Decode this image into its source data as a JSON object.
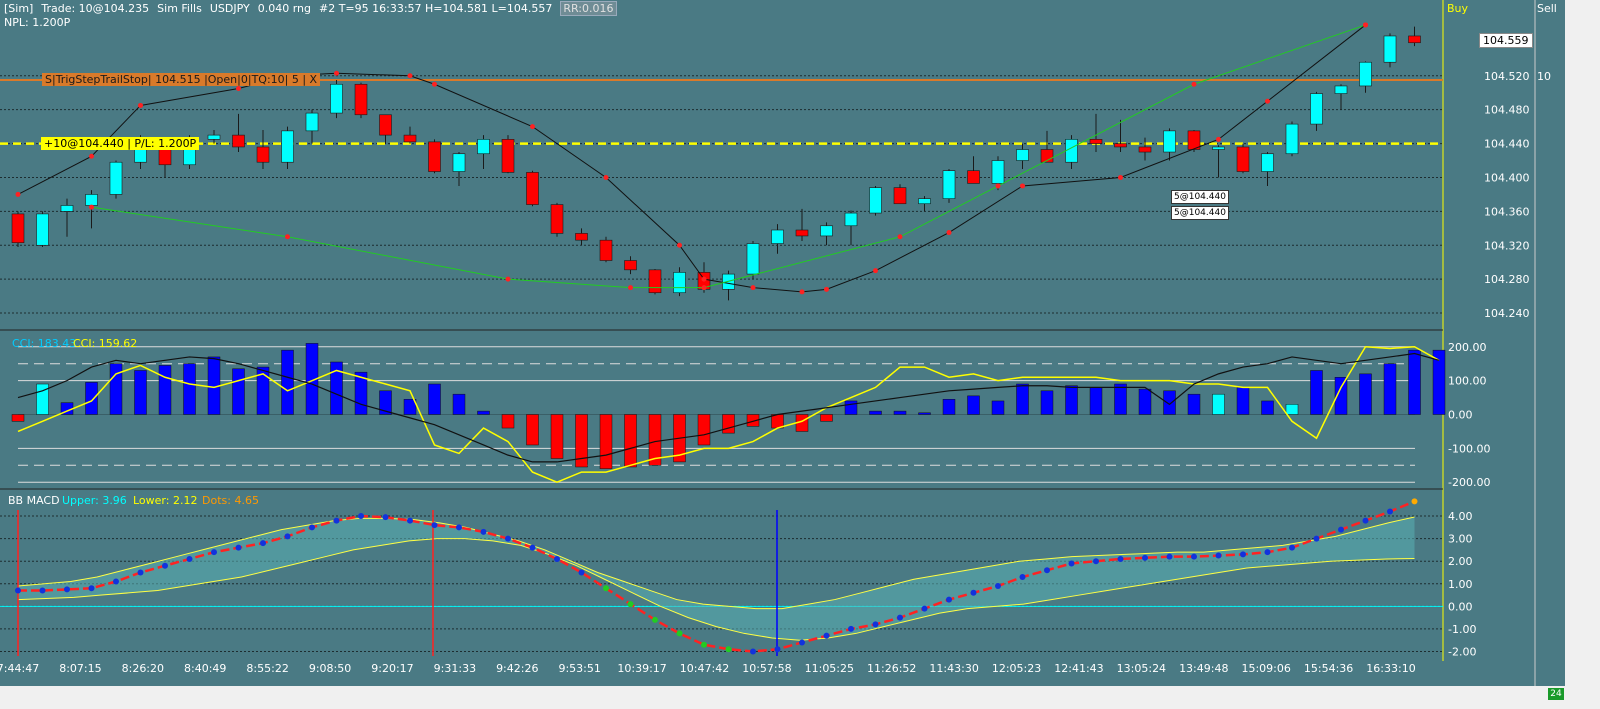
{
  "toolbar": {
    "account": "[Sim]",
    "trade": "Trade: 10@104.235",
    "fills": "Sim Fills",
    "instrument": "USDJPY",
    "range": "0.040 rng",
    "info": "#2 T=95 16:33:57 H=104.581 L=104.557",
    "rr": "RR:0.016"
  },
  "npl": "NPL: 1.200P",
  "order_label": "S|TrigStepTrailStop| 104.515 |Open|0|TQ:10| 5 | X",
  "position_label": "+10@104.440 | P/L: 1.200P",
  "fill_labels": [
    "5@104.440",
    "5@104.440"
  ],
  "buy_label": "Buy",
  "sell_label": "Sell",
  "current_price": "104.559",
  "quantity": "10",
  "corner_badge": "24",
  "colors": {
    "background": "#4a7a84",
    "bull": "#00ffff",
    "bear": "#ff0000",
    "order_line": "#d97a2a",
    "position_line": "#ffff00",
    "macd_band": "#5ab0b4"
  },
  "chart_data": [
    {
      "type": "candlestick",
      "instrument": "USDJPY",
      "ylim": [
        104.22,
        104.6
      ],
      "y_ticks": [
        "104.520",
        "104.480",
        "104.440",
        "104.400",
        "104.360",
        "104.320",
        "104.280",
        "104.240"
      ],
      "candles": [
        [
          104.357,
          104.36,
          104.318,
          104.323
        ],
        [
          104.32,
          104.36,
          104.318,
          104.357
        ],
        [
          104.36,
          104.375,
          104.33,
          104.367
        ],
        [
          104.367,
          104.385,
          104.34,
          104.38
        ],
        [
          104.38,
          104.42,
          104.375,
          104.418
        ],
        [
          104.418,
          104.45,
          104.41,
          104.44
        ],
        [
          104.44,
          104.44,
          104.4,
          104.415
        ],
        [
          104.415,
          104.45,
          104.41,
          104.445
        ],
        [
          104.445,
          104.456,
          104.44,
          104.45
        ],
        [
          104.45,
          104.475,
          104.43,
          104.436
        ],
        [
          104.436,
          104.456,
          104.41,
          104.418
        ],
        [
          104.418,
          104.46,
          104.41,
          104.455
        ],
        [
          104.455,
          104.48,
          104.44,
          104.476
        ],
        [
          104.476,
          104.515,
          104.47,
          104.51
        ],
        [
          104.51,
          104.512,
          104.47,
          104.474
        ],
        [
          104.474,
          104.474,
          104.44,
          104.45
        ],
        [
          104.45,
          104.46,
          104.44,
          104.442
        ],
        [
          104.442,
          104.445,
          104.405,
          104.407
        ],
        [
          104.407,
          104.43,
          104.39,
          104.428
        ],
        [
          104.428,
          104.45,
          104.41,
          104.445
        ],
        [
          104.445,
          104.45,
          104.405,
          104.406
        ],
        [
          104.406,
          104.408,
          104.366,
          104.368
        ],
        [
          104.368,
          104.37,
          104.33,
          104.334
        ],
        [
          104.334,
          104.34,
          104.32,
          104.326
        ],
        [
          104.326,
          104.33,
          104.3,
          104.302
        ],
        [
          104.302,
          104.307,
          104.286,
          104.291
        ],
        [
          104.291,
          104.292,
          104.262,
          104.264
        ],
        [
          104.264,
          104.294,
          104.26,
          104.288
        ],
        [
          104.288,
          104.3,
          104.264,
          104.268
        ],
        [
          104.268,
          104.29,
          104.255,
          104.286
        ],
        [
          104.286,
          104.325,
          104.28,
          104.322
        ],
        [
          104.322,
          104.345,
          104.31,
          104.338
        ],
        [
          104.338,
          104.363,
          104.325,
          104.331
        ],
        [
          104.331,
          104.347,
          104.32,
          104.343
        ],
        [
          104.343,
          104.361,
          104.32,
          104.358
        ],
        [
          104.358,
          104.39,
          104.355,
          104.388
        ],
        [
          104.388,
          104.392,
          104.37,
          104.369
        ],
        [
          104.369,
          104.378,
          104.36,
          104.375
        ],
        [
          104.375,
          104.41,
          104.37,
          104.408
        ],
        [
          104.408,
          104.425,
          104.4,
          104.393
        ],
        [
          104.393,
          104.425,
          104.385,
          104.42
        ],
        [
          104.42,
          104.44,
          104.41,
          104.433
        ],
        [
          104.433,
          104.455,
          104.42,
          104.418
        ],
        [
          104.418,
          104.45,
          104.41,
          104.445
        ],
        [
          104.445,
          104.475,
          104.43,
          104.44
        ],
        [
          104.44,
          104.468,
          104.43,
          104.436
        ],
        [
          104.436,
          104.447,
          104.42,
          104.43
        ],
        [
          104.43,
          104.458,
          104.42,
          104.455
        ],
        [
          104.455,
          104.456,
          104.43,
          104.433
        ],
        [
          104.433,
          104.438,
          104.4,
          104.436
        ],
        [
          104.436,
          104.44,
          104.405,
          104.407
        ],
        [
          104.407,
          104.43,
          104.39,
          104.428
        ],
        [
          104.428,
          104.466,
          104.425,
          104.463
        ],
        [
          104.463,
          104.501,
          104.455,
          104.499
        ],
        [
          104.499,
          104.51,
          104.48,
          104.508
        ],
        [
          104.508,
          104.537,
          104.5,
          104.536
        ],
        [
          104.536,
          104.57,
          104.53,
          104.567
        ],
        [
          104.567,
          104.578,
          104.555,
          104.559
        ]
      ],
      "hours": [
        "8:07:15",
        "8:26:20",
        "8:40:49",
        "8:55:22",
        "9:08:50",
        "9:20:17",
        "9:31:33",
        "9:42:26",
        "9:53:51",
        "10:39:17",
        "10:47:42",
        "10:57:58",
        "11:05:25",
        "11:26:52",
        "11:43:30",
        "12:05:23",
        "12:41:43",
        "13:05:24",
        "13:49:48",
        "15:09:06",
        "15:54:36",
        "16:33:10"
      ],
      "order_price": 104.515,
      "position_price": 104.44
    },
    {
      "type": "bar",
      "title": "CCI: 183.43",
      "title2": "CCI: 159.62",
      "ylim": [
        -220,
        220
      ],
      "y_ticks": [
        "200.00",
        "100.00",
        "0.00",
        "-100.00",
        "-200.00"
      ],
      "values": [
        -20,
        90,
        35,
        95,
        150,
        130,
        145,
        150,
        170,
        135,
        140,
        190,
        210,
        155,
        125,
        70,
        45,
        90,
        60,
        10,
        -40,
        -90,
        -130,
        -155,
        -160,
        -155,
        -150,
        -140,
        -90,
        -55,
        -35,
        -40,
        -50,
        -20,
        40,
        10,
        10,
        5,
        45,
        55,
        40,
        90,
        70,
        85,
        80,
        90,
        75,
        70,
        60,
        60,
        80,
        40,
        30,
        130,
        110,
        120,
        150,
        190,
        190
      ],
      "cci2": [
        -50,
        -20,
        10,
        40,
        120,
        145,
        110,
        90,
        80,
        100,
        120,
        70,
        100,
        130,
        110,
        90,
        70,
        -90,
        -115,
        -40,
        -80,
        -170,
        -200,
        -170,
        -170,
        -150,
        -130,
        -120,
        -100,
        -100,
        -80,
        -40,
        -20,
        20,
        50,
        80,
        140,
        140,
        110,
        120,
        100,
        110,
        110,
        110,
        110,
        100,
        100,
        100,
        90,
        90,
        80,
        80,
        -20,
        -70,
        80,
        200,
        195,
        200,
        160
      ],
      "cci_black": [
        50,
        70,
        100,
        140,
        160,
        150,
        160,
        170,
        165,
        150,
        130,
        110,
        90,
        60,
        30,
        10,
        -10,
        -30,
        -60,
        -90,
        -120,
        -140,
        -140,
        -130,
        -120,
        -100,
        -80,
        -70,
        -60,
        -40,
        -20,
        0,
        10,
        20,
        30,
        40,
        50,
        60,
        70,
        75,
        80,
        85,
        85,
        80,
        80,
        80,
        80,
        30,
        90,
        120,
        140,
        150,
        170,
        160,
        150,
        160,
        170,
        180,
        160
      ]
    },
    {
      "type": "line",
      "title": "BB MACD",
      "upper_label": "Upper: 3.96",
      "lower_label": "Lower: 2.12",
      "dots_label": "Dots: 4.65",
      "ylim": [
        -2.2,
        4.8
      ],
      "y_ticks": [
        "4.00",
        "3.00",
        "2.00",
        "1.00",
        "0.00",
        "-1.00",
        "-2.00"
      ],
      "macd": [
        0.7,
        0.7,
        0.75,
        0.8,
        1.1,
        1.5,
        1.8,
        2.1,
        2.4,
        2.6,
        2.8,
        3.1,
        3.5,
        3.8,
        4.0,
        3.95,
        3.8,
        3.6,
        3.5,
        3.3,
        3.0,
        2.6,
        2.1,
        1.5,
        0.8,
        0.1,
        -0.6,
        -1.2,
        -1.7,
        -1.9,
        -2.0,
        -1.9,
        -1.6,
        -1.3,
        -1.0,
        -0.8,
        -0.5,
        -0.1,
        0.3,
        0.6,
        0.9,
        1.3,
        1.6,
        1.9,
        2.0,
        2.1,
        2.15,
        2.2,
        2.2,
        2.25,
        2.3,
        2.4,
        2.6,
        3.0,
        3.4,
        3.8,
        4.2,
        4.65
      ],
      "upper": [
        0.9,
        1.0,
        1.1,
        1.3,
        1.6,
        1.9,
        2.2,
        2.5,
        2.8,
        3.1,
        3.4,
        3.6,
        3.8,
        3.9,
        3.9,
        3.85,
        3.7,
        3.5,
        3.2,
        2.9,
        2.5,
        2.0,
        1.5,
        1.1,
        0.7,
        0.3,
        0.1,
        0.0,
        -0.1,
        -0.1,
        0.1,
        0.3,
        0.6,
        0.9,
        1.2,
        1.4,
        1.6,
        1.8,
        2.0,
        2.1,
        2.2,
        2.25,
        2.3,
        2.35,
        2.4,
        2.4,
        2.5,
        2.6,
        2.7,
        2.9,
        3.1,
        3.4,
        3.7,
        3.96
      ],
      "lower": [
        0.3,
        0.35,
        0.4,
        0.5,
        0.6,
        0.7,
        0.9,
        1.1,
        1.3,
        1.6,
        1.9,
        2.2,
        2.5,
        2.7,
        2.9,
        3.0,
        3.0,
        2.9,
        2.7,
        2.3,
        1.8,
        1.2,
        0.6,
        0.0,
        -0.5,
        -0.9,
        -1.2,
        -1.4,
        -1.5,
        -1.4,
        -1.2,
        -0.9,
        -0.6,
        -0.3,
        -0.1,
        0.0,
        0.1,
        0.3,
        0.5,
        0.7,
        0.9,
        1.1,
        1.3,
        1.5,
        1.7,
        1.8,
        1.9,
        2.0,
        2.05,
        2.1,
        2.12
      ],
      "hours": [
        "7:44:47",
        "8:07:15",
        "8:26:20",
        "8:40:49",
        "8:55:22",
        "9:08:50",
        "9:20:17",
        "9:31:33",
        "9:42:26",
        "9:53:51",
        "10:39:17",
        "10:47:42",
        "10:57:58",
        "11:05:25",
        "11:26:52",
        "11:43:30",
        "12:05:23",
        "12:41:43",
        "13:05:24",
        "13:49:48",
        "15:09:06",
        "15:54:36",
        "16:33:10"
      ]
    }
  ]
}
